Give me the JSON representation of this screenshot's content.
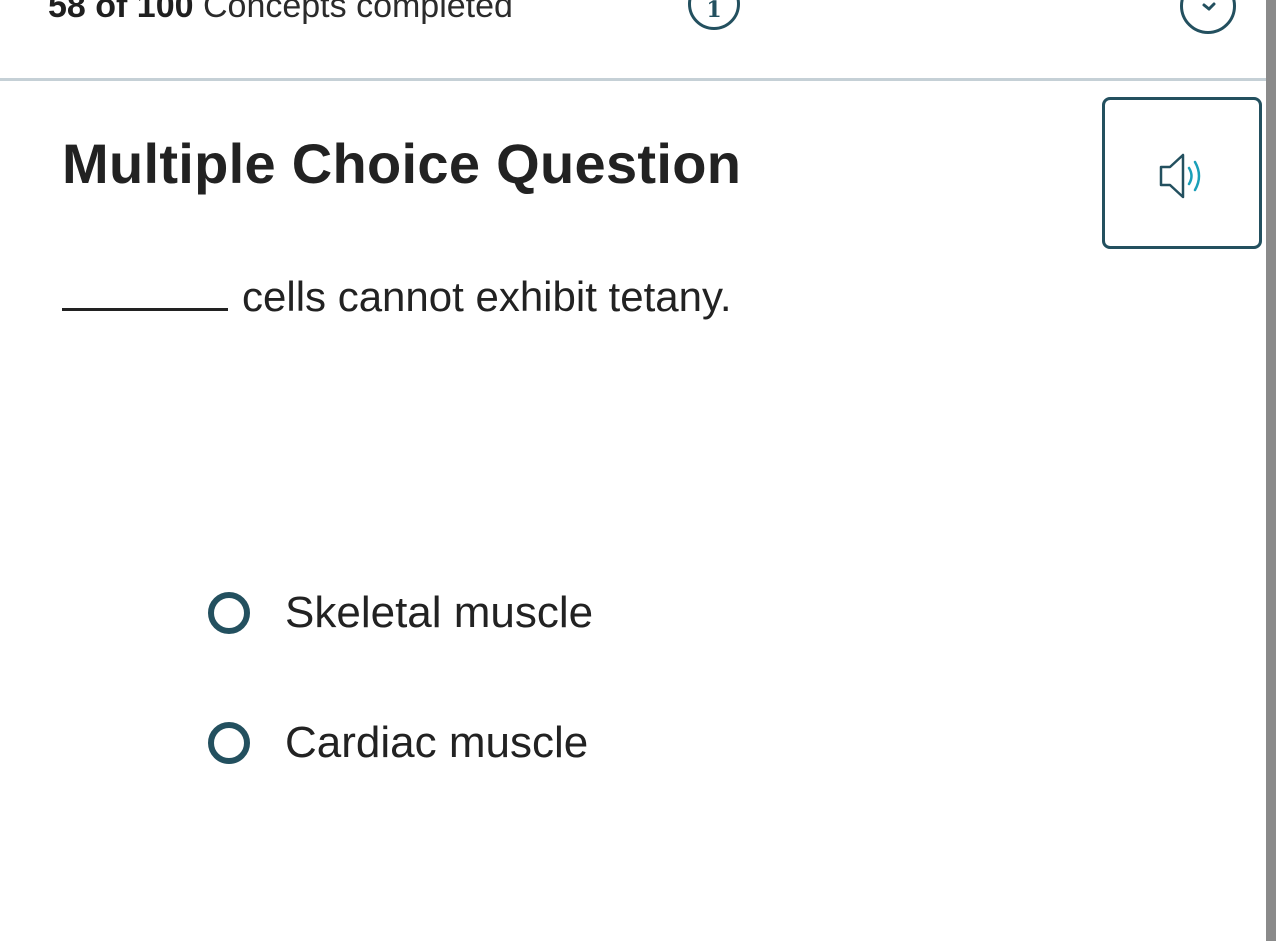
{
  "header": {
    "progress_bold": "58 of 100",
    "progress_rest": "Concepts completed",
    "info_badge_label": "1"
  },
  "question": {
    "title": "Multiple Choice Question",
    "prompt": "cells cannot exhibit tetany.",
    "choices": [
      {
        "label": "Skeletal muscle"
      },
      {
        "label": "Cardiac muscle"
      }
    ]
  },
  "colors": {
    "accent": "#23505f",
    "audio_wave": "#1a9fb8",
    "divider": "#c5d0d6",
    "text": "#222222",
    "scrollbar": "#8a8a8a"
  }
}
